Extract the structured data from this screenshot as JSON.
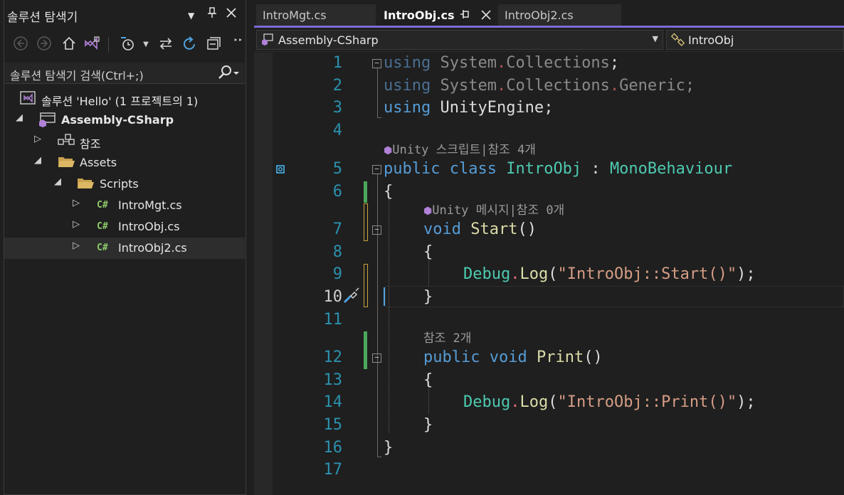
{
  "solution_explorer": {
    "title": "솔루션 탐색기",
    "title_buttons": {
      "dropdown": "▼",
      "pin": "⬍",
      "close": "✕"
    },
    "search_placeholder": "솔루션 탐색기 검색(Ctrl+;)",
    "tree": [
      {
        "label": "솔루션 'Hello' (1 프로젝트의 1)",
        "icon": "solution-icon"
      },
      {
        "label": "Assembly-CSharp",
        "icon": "csharp-project-icon",
        "expanded": true
      },
      {
        "label": "참조",
        "icon": "references-icon",
        "expanded": false
      },
      {
        "label": "Assets",
        "icon": "folder-icon",
        "expanded": true
      },
      {
        "label": "Scripts",
        "icon": "folder-icon",
        "expanded": true
      },
      {
        "label": "IntroMgt.cs",
        "icon": "csharp-file-icon"
      },
      {
        "label": "IntroObj.cs",
        "icon": "csharp-file-icon"
      },
      {
        "label": "IntroObj2.cs",
        "icon": "csharp-file-icon",
        "selected": true
      }
    ],
    "cs_glyph": "C#"
  },
  "tabs": [
    {
      "label": "IntroMgt.cs",
      "active": false
    },
    {
      "label": "IntroObj.cs",
      "active": true
    },
    {
      "label": "IntroObj2.cs",
      "active": false
    }
  ],
  "tab_buttons": {
    "pin": "⬍",
    "close": "✕"
  },
  "navbar": {
    "project": "Assembly-CSharp",
    "class": "IntroObj"
  },
  "editor": {
    "line_numbers": [
      "1",
      "2",
      "3",
      "4",
      "5",
      "6",
      "7",
      "8",
      "9",
      "10",
      "11",
      "12",
      "13",
      "14",
      "15",
      "16",
      "17"
    ],
    "current_line": "10",
    "code_lens": {
      "class": "Unity 스크립트|참조 4개",
      "start": "Unity 메시지|참조 0개",
      "print": "참조 2개"
    },
    "lines": {
      "l1": [
        "using",
        " System",
        ".",
        "Collections",
        ";"
      ],
      "l2": [
        "using",
        " System",
        ".",
        "Collections",
        ".",
        "Generic",
        ";"
      ],
      "l3": [
        "using",
        " UnityEngine",
        ";"
      ],
      "l5": [
        "public",
        " class",
        " IntroObj",
        " : ",
        "MonoBehaviour"
      ],
      "l6": "{",
      "l7": [
        "void",
        " Start",
        "()"
      ],
      "l8": "{",
      "l9": [
        "Debug",
        ".",
        "Log",
        "(",
        "\"IntroObj::Start()\"",
        ");"
      ],
      "l10": "}",
      "l12": [
        "public",
        " void",
        " Print",
        "()"
      ],
      "l13": "{",
      "l14": [
        "Debug",
        ".",
        "Log",
        "(",
        "\"IntroObj::Print()\"",
        ");"
      ],
      "l15": "}",
      "l16": "}"
    }
  },
  "colors": {
    "keyword": "#569cd6",
    "type": "#4ec9b0",
    "method": "#dcdcaa",
    "string": "#d69d85",
    "line_number": "#2b91af",
    "accent": "#7f6ad6"
  }
}
